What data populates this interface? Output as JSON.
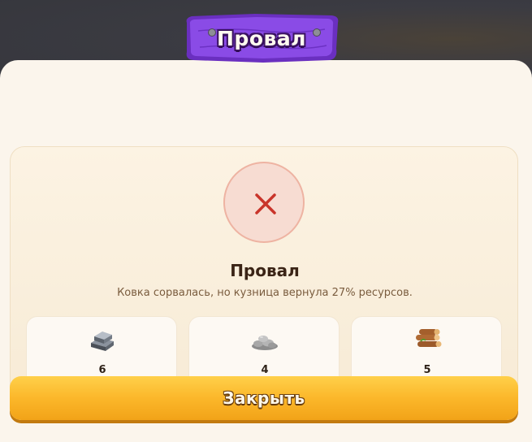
{
  "dialog": {
    "banner_title": "Провал",
    "result_title": "Провал",
    "result_message": "Ковка сорвалась, но кузница вернула 27% ресурсов.",
    "status_icon": "close-icon",
    "close_label": "Закрыть"
  },
  "resources": [
    {
      "icon": "iron-ingot-icon",
      "count": "6"
    },
    {
      "icon": "stone-icon",
      "count": "4"
    },
    {
      "icon": "wood-logs-icon",
      "count": "5"
    }
  ],
  "colors": {
    "banner": "#7b3fd6",
    "fail_accent": "#c9342a",
    "button": "#fbb72a",
    "panel": "#fbf5ec"
  }
}
